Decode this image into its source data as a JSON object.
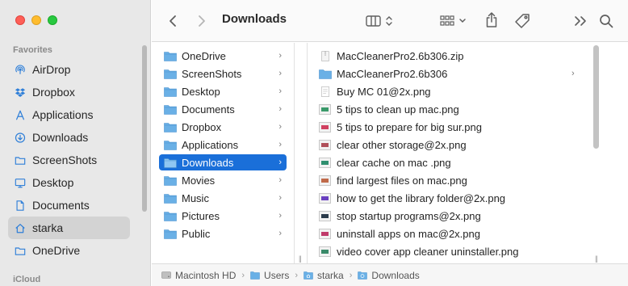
{
  "window": {
    "title": "Downloads"
  },
  "sidebar": {
    "favorites_label": "Favorites",
    "icloud_label": "iCloud",
    "items": [
      {
        "label": "AirDrop",
        "icon": "airdrop-icon"
      },
      {
        "label": "Dropbox",
        "icon": "dropbox-icon"
      },
      {
        "label": "Applications",
        "icon": "applications-icon"
      },
      {
        "label": "Downloads",
        "icon": "downloads-icon"
      },
      {
        "label": "ScreenShots",
        "icon": "folder-icon"
      },
      {
        "label": "Desktop",
        "icon": "desktop-icon"
      },
      {
        "label": "Documents",
        "icon": "document-icon"
      },
      {
        "label": "starka",
        "icon": "home-icon",
        "active": true
      },
      {
        "label": "OneDrive",
        "icon": "folder-icon"
      }
    ]
  },
  "column1": {
    "items": [
      {
        "label": "OneDrive"
      },
      {
        "label": "ScreenShots"
      },
      {
        "label": "Desktop"
      },
      {
        "label": "Documents"
      },
      {
        "label": "Dropbox"
      },
      {
        "label": "Applications"
      },
      {
        "label": "Downloads",
        "selected": true
      },
      {
        "label": "Movies"
      },
      {
        "label": "Music"
      },
      {
        "label": "Pictures"
      },
      {
        "label": "Public"
      }
    ],
    "chevron": "›"
  },
  "column2": {
    "items": [
      {
        "label": "MacCleanerPro2.6b306.zip",
        "kind": "zip"
      },
      {
        "label": "MacCleanerPro2.6b306",
        "kind": "folder"
      },
      {
        "label": "Buy MC 01@2x.png",
        "kind": "doc"
      },
      {
        "label": "5 tips to clean up mac.png",
        "kind": "image",
        "tint": "#3a9a6a"
      },
      {
        "label": "5 tips to prepare for big sur.png",
        "kind": "image",
        "tint": "#d04060"
      },
      {
        "label": "clear other storage@2x.png",
        "kind": "image",
        "tint": "#b0505a"
      },
      {
        "label": "clear cache on mac .png",
        "kind": "image",
        "tint": "#2f8f6f"
      },
      {
        "label": "find largest files on mac.png",
        "kind": "image",
        "tint": "#c06a4a"
      },
      {
        "label": "how to get the library folder@2x.png",
        "kind": "image",
        "tint": "#6a40c0"
      },
      {
        "label": "stop startup programs@2x.png",
        "kind": "image",
        "tint": "#2a3a4a"
      },
      {
        "label": "uninstall apps on mac@2x.png",
        "kind": "image",
        "tint": "#c03a6a"
      },
      {
        "label": "video cover app cleaner uninstaller.png",
        "kind": "image",
        "tint": "#3a8a6a"
      }
    ],
    "chevron": "›"
  },
  "pathbar": {
    "segments": [
      {
        "label": "Macintosh HD",
        "icon": "disk-icon"
      },
      {
        "label": "Users",
        "icon": "folder-icon"
      },
      {
        "label": "starka",
        "icon": "home-icon"
      },
      {
        "label": "Downloads",
        "icon": "downloads-folder-icon"
      }
    ],
    "separator": "›"
  },
  "colors": {
    "accent": "#1a6fd9",
    "folder": "#6ab0e6",
    "sidebar_icon": "#2f7fd8"
  }
}
